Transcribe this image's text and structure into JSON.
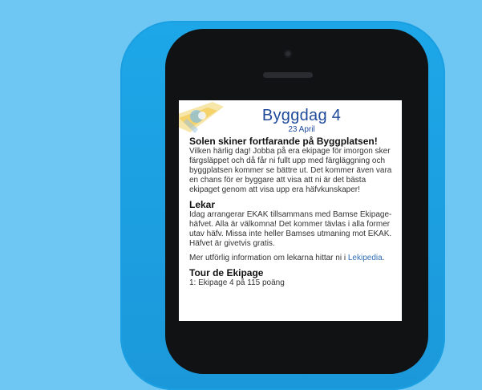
{
  "page": {
    "title": "Byggdag 4",
    "date": "23 April",
    "sections": [
      {
        "heading": "Solen skiner fortfarande på Byggplatsen!",
        "paragraphs": [
          "Vilken härlig dag! Jobba på era ekipage för imorgon sker färgsläppet och då får ni fullt upp med färgläggning och byggplatsen kommer se bättre ut. Det kommer även vara en chans för er byggare att visa att ni är det bästa ekipaget genom att visa upp era häfvkunskaper!"
        ]
      },
      {
        "heading": "Lekar",
        "paragraphs": [
          "Idag arrangerar EKAK tillsammans med Bamse Ekipage-häfvet. Alla är välkomna! Det kommer tävlas i alla former utav häfv. Missa inte heller Bamses utmaning mot EKAK. Häfvet är givetvis gratis."
        ],
        "more_info_prefix": "Mer utförlig information om lekarna hittar ni i ",
        "more_info_link": "Lekipedia",
        "more_info_suffix": "."
      },
      {
        "heading": "Tour de Ekipage",
        "paragraphs": [
          "1: Ekipage 4 på 115 poäng"
        ]
      }
    ]
  },
  "colors": {
    "background": "#6ec6f2",
    "phone": "#1b98da",
    "title": "#1f4a9a",
    "link": "#2f6db3"
  }
}
